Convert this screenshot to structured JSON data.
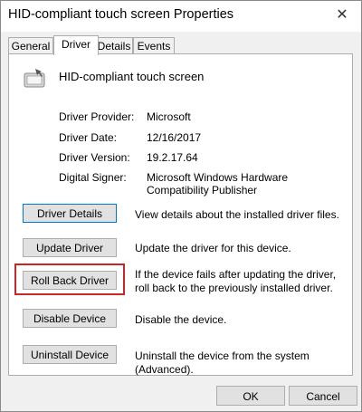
{
  "window": {
    "title": "HID-compliant touch screen Properties"
  },
  "tabs": [
    {
      "label": "General"
    },
    {
      "label": "Driver"
    },
    {
      "label": "Details"
    },
    {
      "label": "Events"
    }
  ],
  "device": {
    "name": "HID-compliant touch screen",
    "icon": "touch-screen-device-icon"
  },
  "info": [
    {
      "label": "Driver Provider:",
      "value": "Microsoft"
    },
    {
      "label": "Driver Date:",
      "value": "12/16/2017"
    },
    {
      "label": "Driver Version:",
      "value": "19.2.17.64"
    },
    {
      "label": "Digital Signer:",
      "value": "Microsoft Windows Hardware Compatibility Publisher"
    }
  ],
  "actions": [
    {
      "button": "Driver Details",
      "description": "View details about the installed driver files."
    },
    {
      "button": "Update Driver",
      "description": "Update the driver for this device."
    },
    {
      "button": "Roll Back Driver",
      "description": "If the device fails after updating the driver, roll back to the previously installed driver."
    },
    {
      "button": "Disable Device",
      "description": "Disable the device."
    },
    {
      "button": "Uninstall Device",
      "description": "Uninstall the device from the system (Advanced)."
    }
  ],
  "dialog_buttons": {
    "ok": "OK",
    "cancel": "Cancel"
  },
  "colors": {
    "focus_border": "#0078d7",
    "highlight_border": "#c62828",
    "button_bg": "#e1e1e1"
  }
}
